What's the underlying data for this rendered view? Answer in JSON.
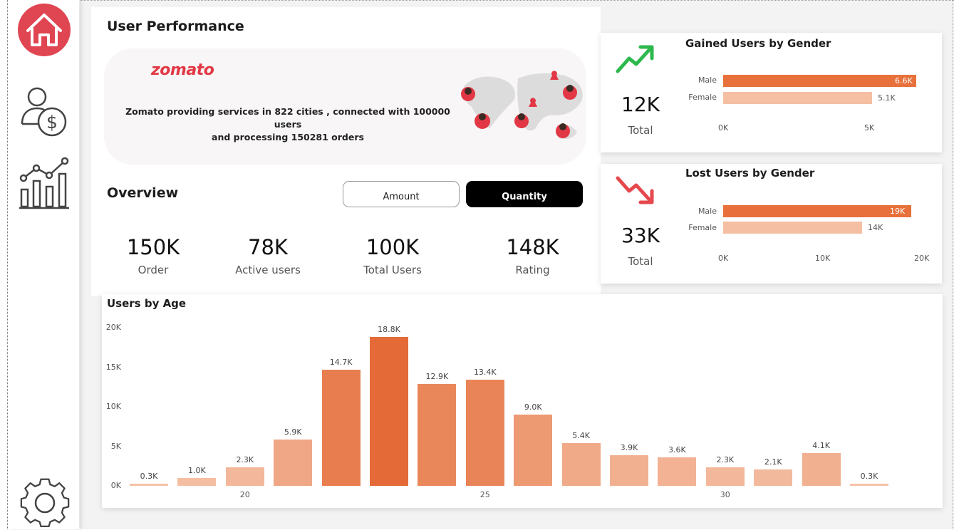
{
  "page": {
    "title": "User Performance",
    "overview_title": "Overview"
  },
  "nav": {
    "items": [
      {
        "icon": "home-icon",
        "active": true
      },
      {
        "icon": "user-dollar-icon",
        "active": false
      },
      {
        "icon": "chart-icon",
        "active": false
      },
      {
        "icon": "gear-icon",
        "active": false
      }
    ],
    "accent": "#E04552"
  },
  "banner": {
    "logo": "zomato",
    "text_line1": "Zomato providing services in 822 cities , connected with 100000 users",
    "text_line2": "and processing 150281 orders",
    "brand_color": "#E23744"
  },
  "toggles": {
    "amount_label": "Amount",
    "quantity_label": "Quantity",
    "selected": "Quantity"
  },
  "kpis": [
    {
      "value": "150K",
      "label": "Order"
    },
    {
      "value": "78K",
      "label": "Active users"
    },
    {
      "value": "100K",
      "label": "Total Users"
    },
    {
      "value": "148K",
      "label": "Rating"
    }
  ],
  "gained": {
    "title": "Gained Users by Gender",
    "total_value": "12K",
    "total_label": "Total",
    "trend_icon": "trend-up-icon",
    "trend_color": "#2DB84C",
    "axis": [
      "0K",
      "5K"
    ],
    "bars": [
      {
        "label": "Male",
        "value": 6.6,
        "display": "6.6K",
        "color": "#E8703A"
      },
      {
        "label": "Female",
        "value": 5.1,
        "display": "5.1K",
        "color": "#F4BFA2"
      }
    ]
  },
  "lost": {
    "title": "Lost Users by Gender",
    "total_value": "33K",
    "total_label": "Total",
    "trend_icon": "trend-down-icon",
    "trend_color": "#E5484D",
    "axis": [
      "0K",
      "10K",
      "20K"
    ],
    "bars": [
      {
        "label": "Male",
        "value": 19,
        "display": "19K",
        "color": "#E8703A"
      },
      {
        "label": "Female",
        "value": 14,
        "display": "14K",
        "color": "#F4BFA2"
      }
    ]
  },
  "chart_data": {
    "type": "bar",
    "title": "Users by Age",
    "ylim": [
      0,
      20000
    ],
    "yticks": [
      "0K",
      "5K",
      "10K",
      "15K",
      "20K"
    ],
    "xticks": [
      "20",
      "25",
      "30"
    ],
    "categories": [
      18,
      19,
      20,
      21,
      22,
      23,
      24,
      25,
      26,
      27,
      28,
      29,
      30,
      31,
      32,
      33
    ],
    "values": [
      300,
      1000,
      2300,
      5900,
      14700,
      18800,
      12900,
      13400,
      9000,
      5400,
      3900,
      3600,
      2300,
      2100,
      4100,
      300
    ],
    "labels": [
      "0.3K",
      "1.0K",
      "2.3K",
      "5.9K",
      "14.7K",
      "18.8K",
      "12.9K",
      "13.4K",
      "9.0K",
      "5.4K",
      "3.9K",
      "3.6K",
      "2.3K",
      "2.1K",
      "4.1K",
      "0.3K"
    ],
    "colors": {
      "high": "#E46B37",
      "low": "#F5C3A9"
    }
  }
}
